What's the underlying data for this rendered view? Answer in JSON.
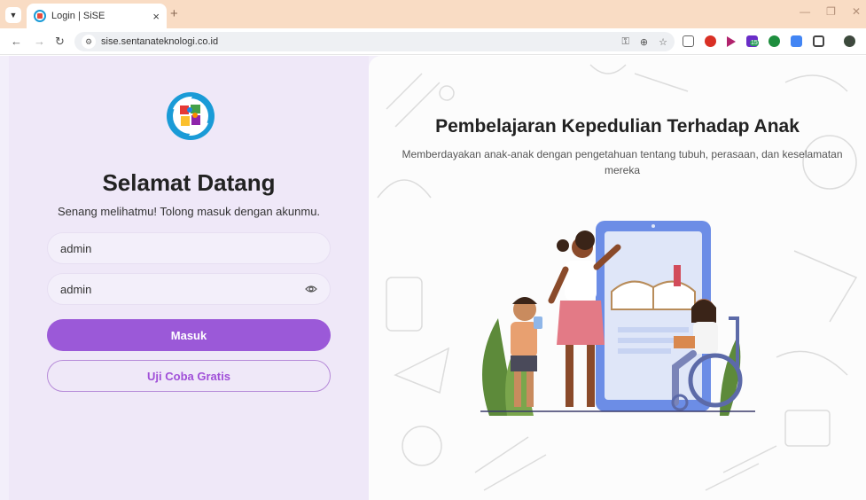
{
  "browser": {
    "tab_title": "Login | SiSE",
    "url": "sise.sentanateknologi.co.id",
    "new_tab_label": "+",
    "tab_close_label": "×",
    "ext_badge": "15"
  },
  "login": {
    "welcome_title": "Selamat Datang",
    "welcome_subtitle": "Senang melihatmu! Tolong masuk dengan akunmu.",
    "username_value": "admin",
    "password_value": "admin",
    "submit_label": "Masuk",
    "trial_label": "Uji Coba Gratis"
  },
  "hero": {
    "title": "Pembelajaran Kepedulian Terhadap Anak",
    "subtitle": "Memberdayakan anak-anak dengan pengetahuan tentang tubuh, perasaan, dan keselamatan mereka"
  },
  "colors": {
    "tabbar": "#f9dcc4",
    "left_bg": "#efe8f8",
    "primary": "#9b59d8",
    "outline_text": "#a04fd8"
  }
}
